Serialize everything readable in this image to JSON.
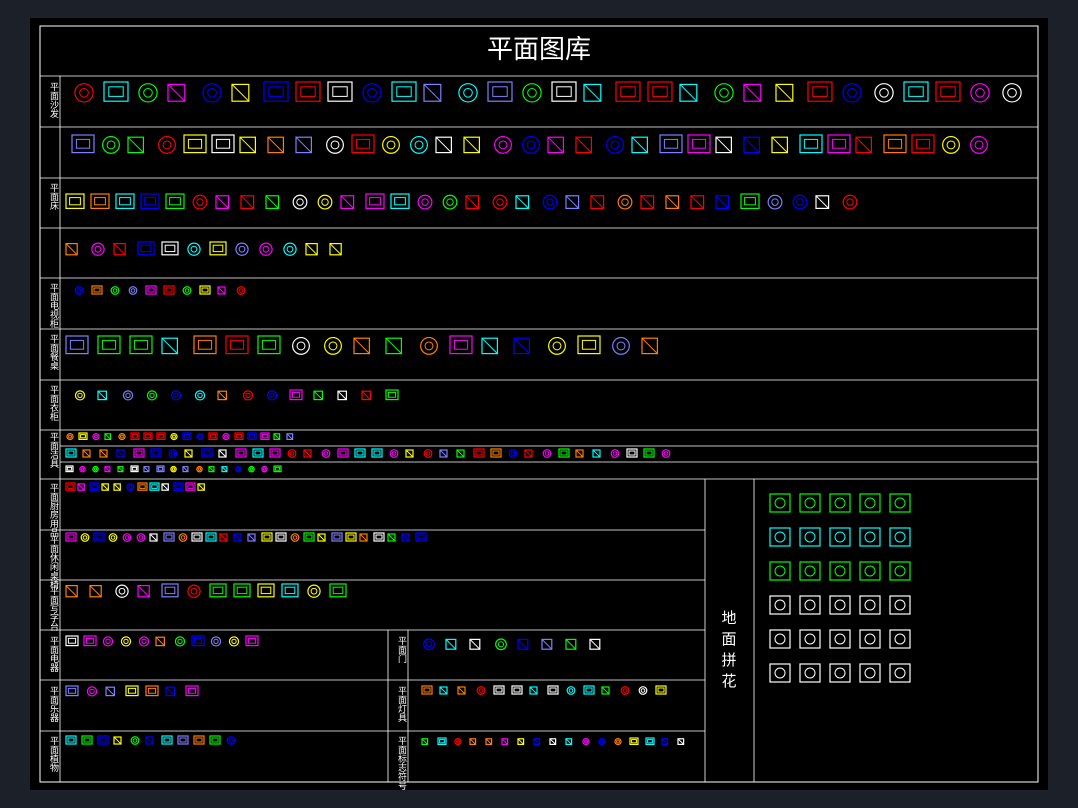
{
  "title": "平面图库",
  "colors": {
    "background": "#000000",
    "frame": "#ffffff",
    "palette": [
      "#ff00ff",
      "#00ffff",
      "#ffff00",
      "#00ff00",
      "#ff0000",
      "#0000ff",
      "#ffffff",
      "#ff7f00",
      "#7f7fff"
    ]
  },
  "rows": [
    {
      "id": "sofa",
      "label": "平面沙发"
    },
    {
      "id": "sofa-2",
      "label": ""
    },
    {
      "id": "bed",
      "label": "平面床"
    },
    {
      "id": "bed-2",
      "label": ""
    },
    {
      "id": "tv-cabinet",
      "label": "平面电视柜"
    },
    {
      "id": "dining-table",
      "label": "平面餐桌"
    },
    {
      "id": "wardrobe",
      "label": "平面衣柜"
    },
    {
      "id": "fixtures",
      "label": "平面洁具"
    },
    {
      "id": "kitchen",
      "label": "平面厨房用品"
    },
    {
      "id": "leisure",
      "label": "平面休闲桌椅"
    },
    {
      "id": "office",
      "label": "平面写字台"
    },
    {
      "id": "appliances",
      "label": "平面电器"
    },
    {
      "id": "door",
      "label": "平面门"
    },
    {
      "id": "instruments",
      "label": "平面乐器"
    },
    {
      "id": "lamps",
      "label": "平面灯具"
    },
    {
      "id": "plants",
      "label": "平面植物"
    },
    {
      "id": "symbols",
      "label": "平面标志符号"
    }
  ],
  "floor_pattern_label": "地面拼花"
}
